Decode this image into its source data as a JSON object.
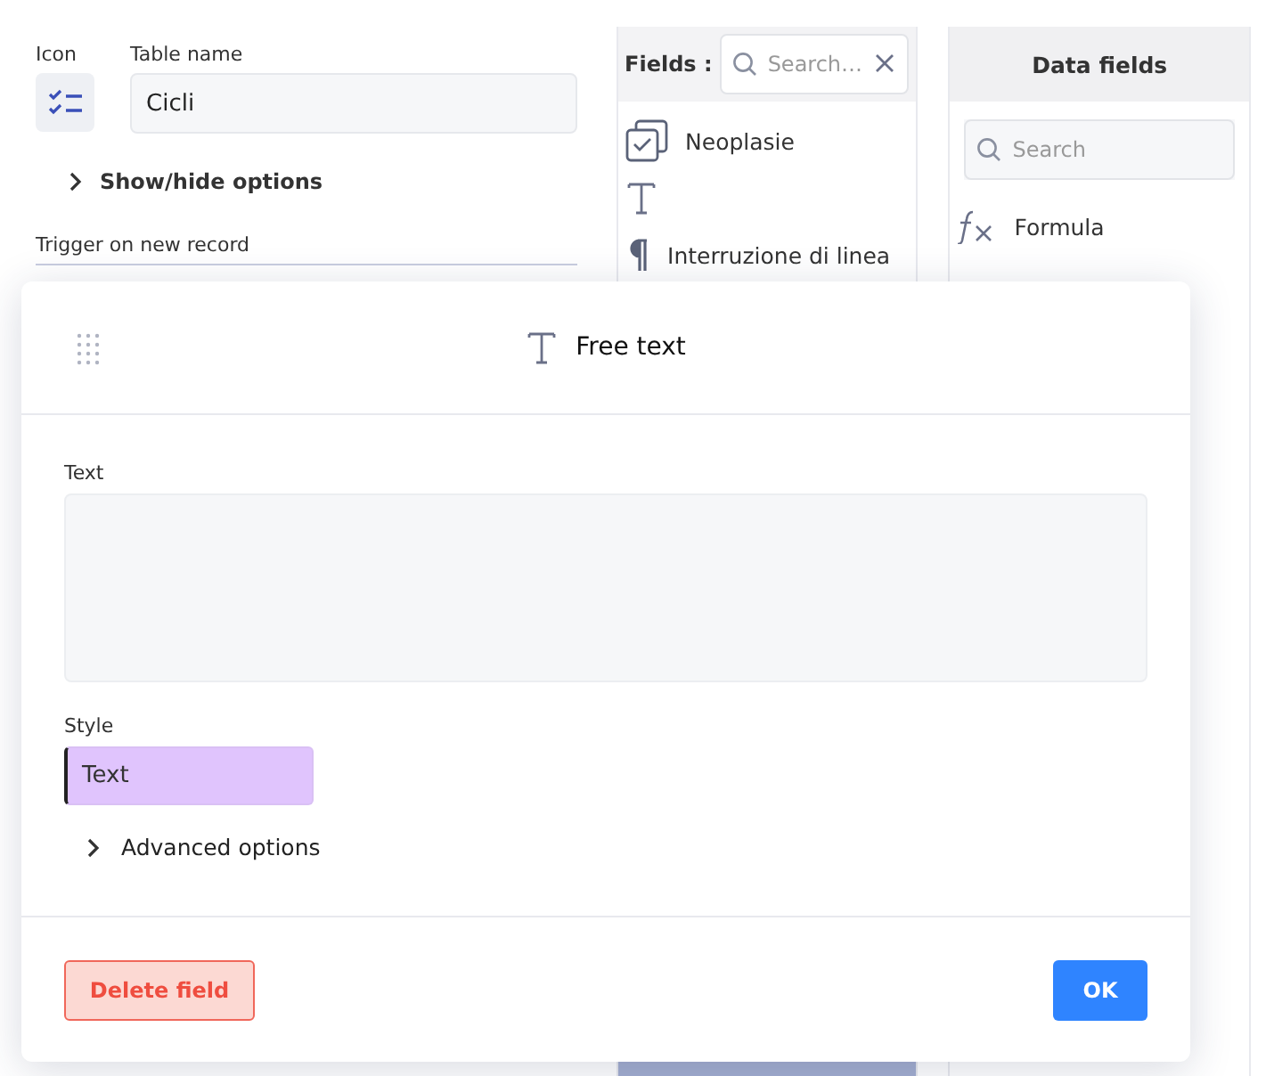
{
  "table_settings": {
    "icon_label": "Icon",
    "name_label": "Table name",
    "name_value": "Cicli",
    "options_toggle": {
      "label": "Show/hide options",
      "expanded": false
    },
    "trigger_label": "Trigger on new record"
  },
  "fields_panel": {
    "label": "Fields :",
    "search_placeholder": "Search…",
    "items": [
      {
        "kind": "checkbox",
        "label": "Neoplasie"
      },
      {
        "kind": "text"
      },
      {
        "kind": "linebreak",
        "label": "Interruzione di linea"
      }
    ]
  },
  "data_fields": {
    "title": "Data fields",
    "search_placeholder": "Search",
    "items": [
      {
        "kind": "formula",
        "label": "Formula"
      }
    ]
  },
  "dialog": {
    "title": "Free text",
    "text_label": "Text",
    "style_label": "Style",
    "style_value": "Text",
    "advanced": {
      "label": "Advanced options",
      "expanded": false
    },
    "buttons": [
      {
        "kind": "danger",
        "label": "Delete field"
      },
      {
        "kind": "primary",
        "label": "OK"
      }
    ]
  }
}
